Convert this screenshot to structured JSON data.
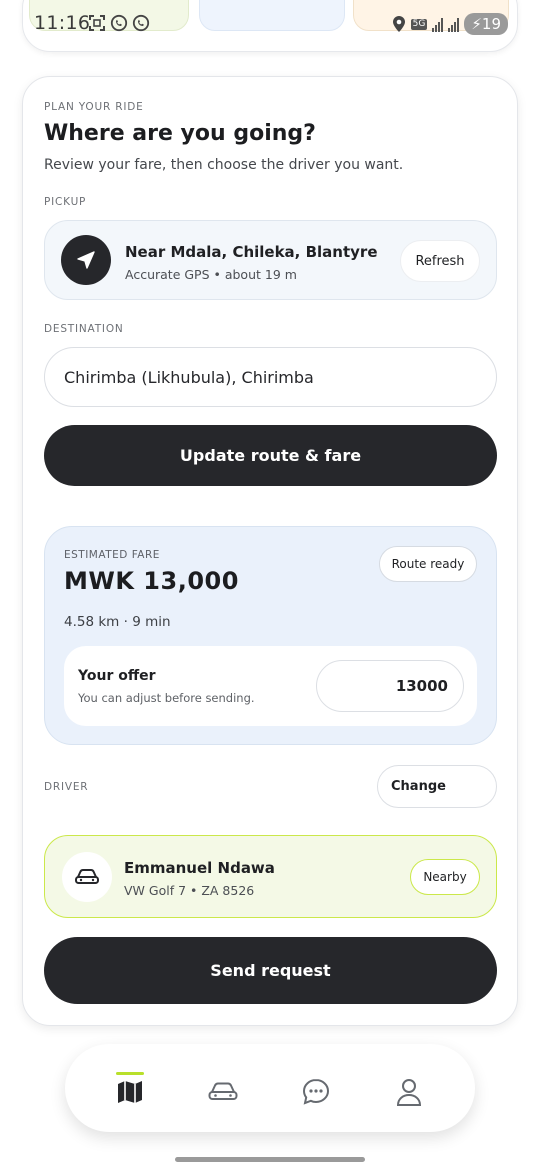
{
  "status_bar": {
    "time": "11:16",
    "network": "5G",
    "battery": "19"
  },
  "plan": {
    "section_label": "PLAN YOUR RIDE",
    "title": "Where are you going?",
    "subtitle": "Review your fare, then choose the driver you want."
  },
  "pickup": {
    "label": "PICKUP",
    "name": "Near Mdala, Chileka, Blantyre",
    "accuracy": "Accurate GPS • about 19 m",
    "refresh_label": "Refresh"
  },
  "destination": {
    "label": "DESTINATION",
    "value": "Chirimba (Likhubula), Chirimba"
  },
  "update_button_label": "Update route & fare",
  "fare": {
    "label": "ESTIMATED FARE",
    "status": "Route ready",
    "amount": "MWK 13,000",
    "distance_time": "4.58 km · 9 min",
    "offer_title": "Your offer",
    "offer_hint": "You can adjust before sending.",
    "offer_value": "13000"
  },
  "driver": {
    "label": "DRIVER",
    "change_label": "Change",
    "name": "Emmanuel Ndawa",
    "vehicle": "VW Golf 7 • ZA 8526",
    "badge": "Nearby"
  },
  "send_button_label": "Send request",
  "bottom_nav": {
    "items": [
      {
        "icon": "map-icon",
        "active": true
      },
      {
        "icon": "car-icon",
        "active": false
      },
      {
        "icon": "chat-icon",
        "active": false
      },
      {
        "icon": "profile-icon",
        "active": false
      }
    ]
  },
  "colors": {
    "dark": "#26272b",
    "accent_green": "#cbe84a",
    "fare_bg": "#eaf1fb",
    "driver_bg": "#f4f9e6"
  }
}
